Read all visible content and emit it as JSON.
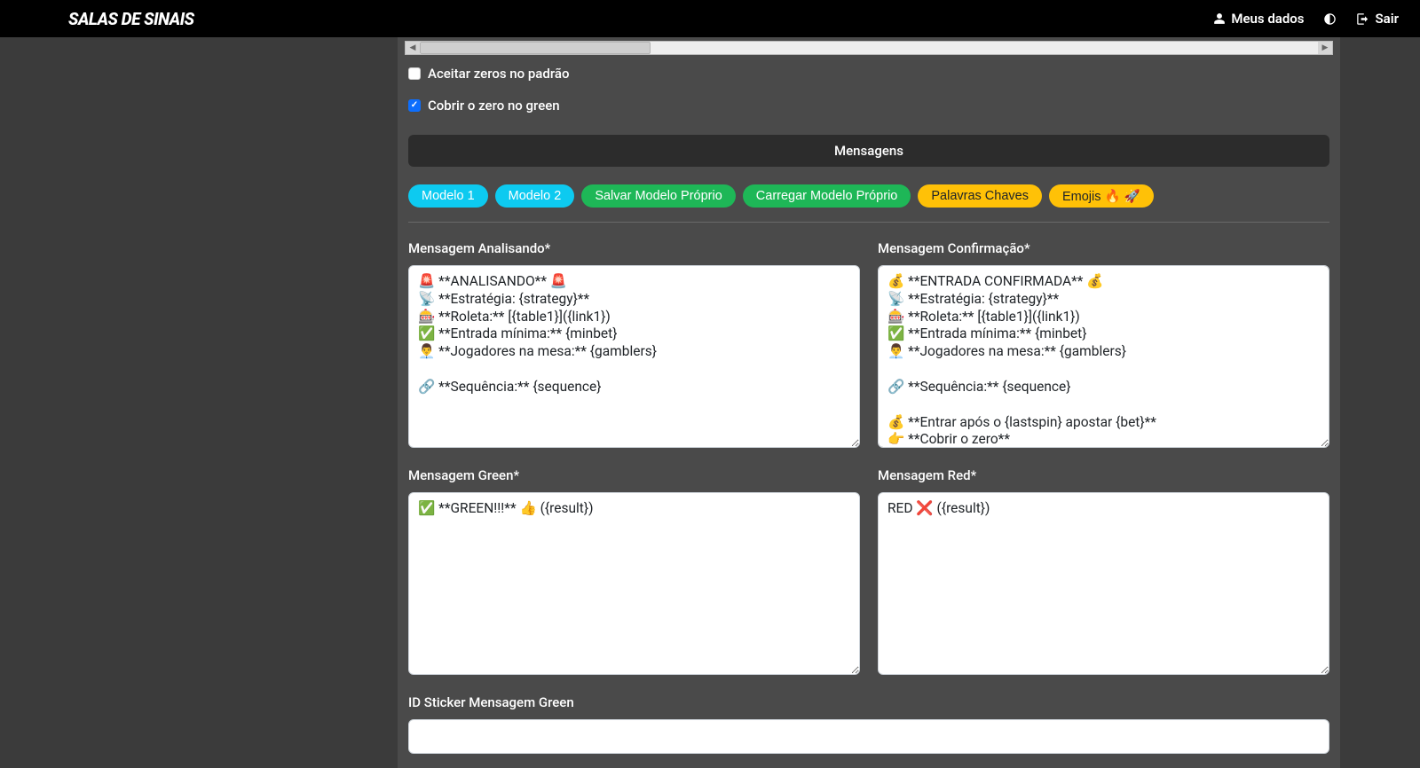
{
  "brand": "SALAS DE SINAIS",
  "topbar": {
    "meus_dados": "Meus dados",
    "sair": "Sair"
  },
  "checks": {
    "aceitar_zeros": {
      "label": "Aceitar zeros no padrão",
      "checked": false
    },
    "cobrir_zero": {
      "label": "Cobrir o zero no green",
      "checked": true
    }
  },
  "section_title": "Mensagens",
  "pills": {
    "modelo1": "Modelo 1",
    "modelo2": "Modelo 2",
    "salvar": "Salvar Modelo Próprio",
    "carregar": "Carregar Modelo Próprio",
    "palavras": "Palavras Chaves",
    "emojis": "Emojis 🔥 🚀"
  },
  "fields": {
    "analisando": {
      "label": "Mensagem Analisando*",
      "value": "🚨 **ANALISANDO** 🚨\n📡 **Estratégia: {strategy}**\n🎰 **Roleta:** [{table1}]({link1})\n✅ **Entrada mínima:** {minbet}\n👨‍💼 **Jogadores na mesa:** {gamblers}\n\n🔗 **Sequência:** {sequence}"
    },
    "confirmacao": {
      "label": "Mensagem Confirmação*",
      "value": "💰 **ENTRADA CONFIRMADA** 💰\n📡 **Estratégia: {strategy}**\n🎰 **Roleta:** [{table1}]({link1})\n✅ **Entrada mínima:** {minbet}\n👨‍💼 **Jogadores na mesa:** {gamblers}\n\n🔗 **Sequência:** {sequence}\n\n💰 **Entrar após o {lastspin} apostar {bet}**\n👉 **Cobrir o zero**"
    },
    "green": {
      "label": "Mensagem Green*",
      "value": "✅ **GREEN!!!** 👍 ({result})"
    },
    "red": {
      "label": "Mensagem Red*",
      "value": "RED ❌ ({result})"
    },
    "sticker_green": {
      "label": "ID Sticker Mensagem Green",
      "value": ""
    }
  }
}
